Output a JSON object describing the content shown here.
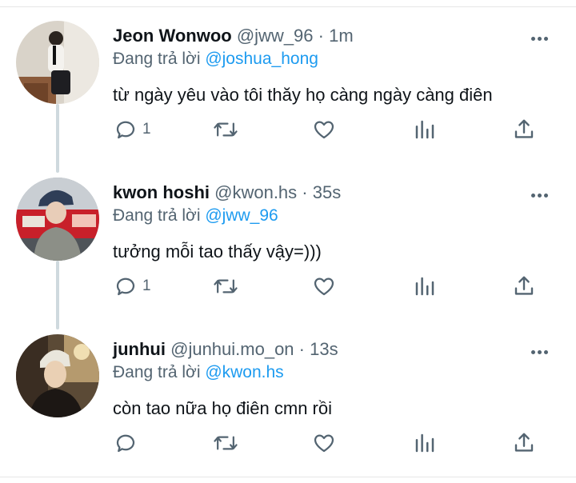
{
  "tweets": [
    {
      "name": "Jeon Wonwoo",
      "handle": "@jww_96",
      "time": "1m",
      "reply_prefix": "Đang trả lời",
      "reply_to": "@joshua_hong",
      "text": "từ ngày yêu vào tôi thăy họ càng ngày càng điên",
      "reply_count": "1"
    },
    {
      "name": "kwon hoshi",
      "handle": "@kwon.hs",
      "time": "35s",
      "reply_prefix": "Đang trả lời",
      "reply_to": "@jww_96",
      "text": "tưởng mỗi tao thấy vậy=)))",
      "reply_count": "1"
    },
    {
      "name": "junhui",
      "handle": "@junhui.mo_on",
      "time": "13s",
      "reply_prefix": "Đang trả lời",
      "reply_to": "@kwon.hs",
      "text": "còn tao nữa họ điên cmn rồi",
      "reply_count": ""
    }
  ],
  "separator": "·",
  "icons": [
    "reply-icon",
    "retweet-icon",
    "like-icon",
    "analytics-icon",
    "share-icon",
    "more-icon"
  ],
  "colors": {
    "mention": "#1d9bf0",
    "secondary": "#536471",
    "thread_line": "#cfd9de",
    "text": "#0f1419"
  }
}
